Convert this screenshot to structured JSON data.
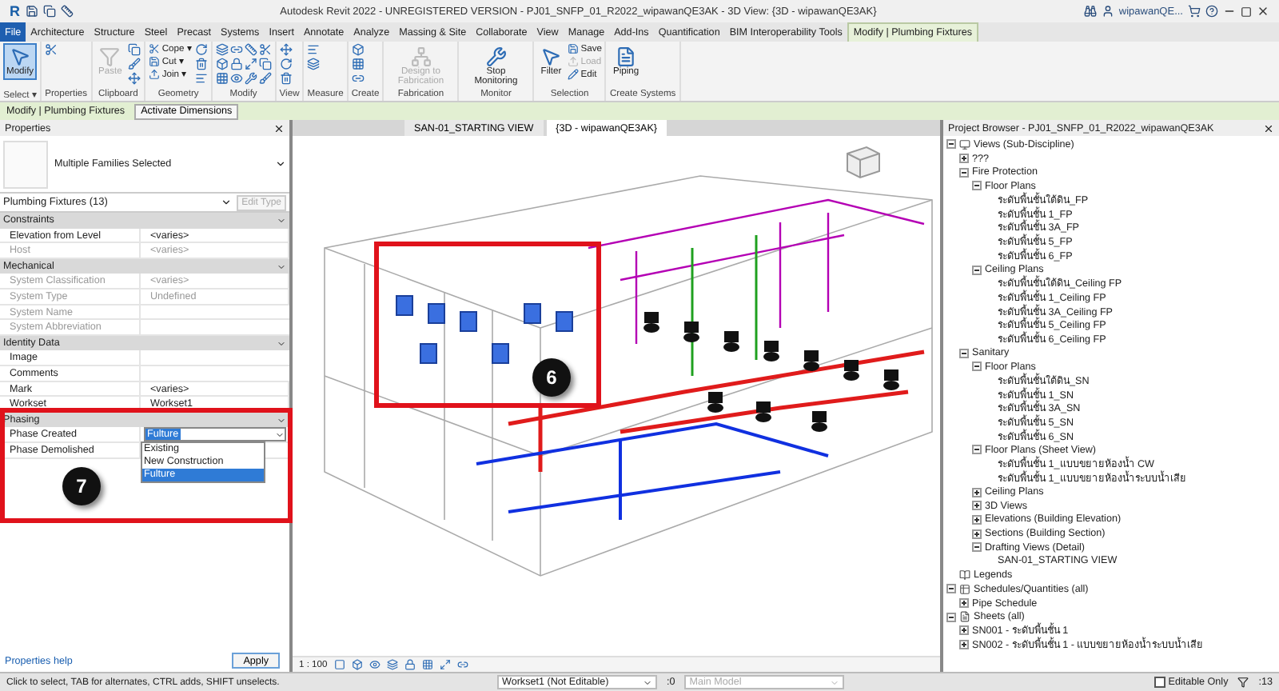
{
  "window": {
    "logo": "R",
    "title": "Autodesk Revit 2022 - UNREGISTERED VERSION - PJ01_SNFP_01_R2022_wipawanQE3AK - 3D View: {3D - wipawanQE3AK}",
    "user": "wipawanQE..."
  },
  "ribbon_tabs": [
    {
      "label": "File",
      "selected": false,
      "kind": "file"
    },
    {
      "label": "Architecture",
      "selected": false
    },
    {
      "label": "Structure",
      "selected": false
    },
    {
      "label": "Steel",
      "selected": false
    },
    {
      "label": "Precast",
      "selected": false
    },
    {
      "label": "Systems",
      "selected": false
    },
    {
      "label": "Insert",
      "selected": false
    },
    {
      "label": "Annotate",
      "selected": false
    },
    {
      "label": "Analyze",
      "selected": false
    },
    {
      "label": "Massing & Site",
      "selected": false
    },
    {
      "label": "Collaborate",
      "selected": false
    },
    {
      "label": "View",
      "selected": false
    },
    {
      "label": "Manage",
      "selected": false
    },
    {
      "label": "Add-Ins",
      "selected": false
    },
    {
      "label": "Quantification",
      "selected": false
    },
    {
      "label": "BIM Interoperability Tools",
      "selected": false
    },
    {
      "label": "Modify | Plumbing Fixtures",
      "selected": true
    }
  ],
  "ribbon_groups": [
    {
      "label": "Select ▾",
      "tools": [
        {
          "kind": "large",
          "label": "Modify",
          "disabled": false,
          "selected": true
        }
      ]
    },
    {
      "label": "Properties",
      "tools": [
        {
          "kind": "icon"
        }
      ]
    },
    {
      "label": "Clipboard",
      "tools": [
        {
          "kind": "large",
          "label": "Paste",
          "disabled": true,
          "selected": false
        },
        {
          "kind": "icon"
        },
        {
          "kind": "icon"
        },
        {
          "kind": "icon"
        }
      ]
    },
    {
      "label": "Geometry",
      "tools": [
        {
          "kind": "small",
          "label": "Cope ▾",
          "disabled": false
        },
        {
          "kind": "small",
          "label": "Cut ▾",
          "disabled": false
        },
        {
          "kind": "small",
          "label": "Join ▾",
          "disabled": false
        },
        {
          "kind": "icon"
        },
        {
          "kind": "icon"
        },
        {
          "kind": "icon"
        }
      ]
    },
    {
      "label": "Modify",
      "tools": [
        {
          "kind": "icon"
        },
        {
          "kind": "icon"
        },
        {
          "kind": "icon"
        },
        {
          "kind": "icon"
        },
        {
          "kind": "icon"
        },
        {
          "kind": "icon"
        },
        {
          "kind": "icon"
        },
        {
          "kind": "icon"
        },
        {
          "kind": "icon"
        },
        {
          "kind": "icon"
        },
        {
          "kind": "icon"
        },
        {
          "kind": "icon"
        }
      ]
    },
    {
      "label": "View",
      "tools": [
        {
          "kind": "icon"
        },
        {
          "kind": "icon"
        },
        {
          "kind": "icon"
        }
      ]
    },
    {
      "label": "Measure",
      "tools": [
        {
          "kind": "icon"
        },
        {
          "kind": "icon"
        }
      ]
    },
    {
      "label": "Create",
      "tools": [
        {
          "kind": "icon"
        },
        {
          "kind": "icon"
        },
        {
          "kind": "icon"
        }
      ]
    },
    {
      "label": "Fabrication",
      "tools": [
        {
          "kind": "large",
          "label": "Design to Fabrication",
          "disabled": true,
          "selected": false
        }
      ]
    },
    {
      "label": "Monitor",
      "tools": [
        {
          "kind": "large",
          "label": "Stop Monitoring",
          "disabled": false,
          "selected": false
        }
      ]
    },
    {
      "label": "Selection",
      "tools": [
        {
          "kind": "large",
          "label": "Filter",
          "disabled": false,
          "selected": false
        },
        {
          "kind": "small",
          "label": "Save",
          "disabled": false
        },
        {
          "kind": "small",
          "label": "Load",
          "disabled": true
        },
        {
          "kind": "small",
          "label": "Edit",
          "disabled": false
        }
      ]
    },
    {
      "label": "Create Systems",
      "tools": [
        {
          "kind": "large",
          "label": "Piping",
          "disabled": false,
          "selected": false
        }
      ]
    }
  ],
  "context_bar": {
    "label": "Modify | Plumbing Fixtures",
    "button": "Activate Dimensions"
  },
  "properties": {
    "title": "Properties",
    "type_name": "Multiple Families Selected",
    "filter": "Plumbing Fixtures (13)",
    "edit_type": "Edit Type",
    "groups": [
      {
        "label": "Constraints",
        "rows": [
          {
            "label": "Elevation from Level",
            "value": "<varies>",
            "disabled": false
          },
          {
            "label": "Host",
            "value": "<varies>",
            "disabled": true
          }
        ]
      },
      {
        "label": "Mechanical",
        "rows": [
          {
            "label": "System Classification",
            "value": "<varies>",
            "disabled": true
          },
          {
            "label": "System Type",
            "value": "Undefined",
            "disabled": true
          },
          {
            "label": "System Name",
            "value": "",
            "disabled": true
          },
          {
            "label": "System Abbreviation",
            "value": "",
            "disabled": true
          }
        ]
      },
      {
        "label": "Identity Data",
        "rows": [
          {
            "label": "Image",
            "value": "",
            "disabled": false
          },
          {
            "label": "Comments",
            "value": "",
            "disabled": false
          },
          {
            "label": "Mark",
            "value": "<varies>",
            "disabled": false
          },
          {
            "label": "Workset",
            "value": "Workset1",
            "disabled": false
          }
        ]
      },
      {
        "label": "Phasing",
        "rows": [
          {
            "label": "Phase Created",
            "value": "Fulture",
            "disabled": false,
            "kind": "dropdown",
            "options": [
              {
                "label": "Existing",
                "selected": false
              },
              {
                "label": "New Construction",
                "selected": false
              },
              {
                "label": "Fulture",
                "selected": true
              }
            ]
          },
          {
            "label": "Phase Demolished",
            "value": "",
            "disabled": false
          }
        ]
      }
    ],
    "help": "Properties help",
    "apply": "Apply"
  },
  "view_tabs": [
    {
      "label": "SAN-01_STARTING VIEW",
      "selected": false
    },
    {
      "label": "{3D - wipawanQE3AK}",
      "selected": true
    }
  ],
  "view_scale": "1 : 100",
  "annotations": [
    {
      "label": "6"
    },
    {
      "label": "7"
    }
  ],
  "project_browser": {
    "title": "Project Browser - PJ01_SNFP_01_R2022_wipawanQE3AK",
    "tree": [
      {
        "label": "Views (Sub-Discipline)",
        "expanded": true,
        "children": [
          {
            "label": "???",
            "expanded": false
          },
          {
            "label": "Fire Protection",
            "expanded": true,
            "children": [
              {
                "label": "Floor Plans",
                "expanded": true,
                "children": [
                  {
                    "label": "ระดับพื้นชั้นใต้ดิน_FP"
                  },
                  {
                    "label": "ระดับพื้นชั้น 1_FP"
                  },
                  {
                    "label": "ระดับพื้นชั้น 3A_FP"
                  },
                  {
                    "label": "ระดับพื้นชั้น 5_FP"
                  },
                  {
                    "label": "ระดับพื้นชั้น 6_FP"
                  }
                ]
              },
              {
                "label": "Ceiling Plans",
                "expanded": true,
                "children": [
                  {
                    "label": "ระดับพื้นชั้นใต้ดิน_Ceiling FP"
                  },
                  {
                    "label": "ระดับพื้นชั้น 1_Ceiling FP"
                  },
                  {
                    "label": "ระดับพื้นชั้น 3A_Ceiling FP"
                  },
                  {
                    "label": "ระดับพื้นชั้น 5_Ceiling FP"
                  },
                  {
                    "label": "ระดับพื้นชั้น 6_Ceiling FP"
                  }
                ]
              }
            ]
          },
          {
            "label": "Sanitary",
            "expanded": true,
            "children": [
              {
                "label": "Floor Plans",
                "expanded": true,
                "children": [
                  {
                    "label": "ระดับพื้นชั้นใต้ดิน_SN"
                  },
                  {
                    "label": "ระดับพื้นชั้น 1_SN"
                  },
                  {
                    "label": "ระดับพื้นชั้น 3A_SN"
                  },
                  {
                    "label": "ระดับพื้นชั้น 5_SN"
                  },
                  {
                    "label": "ระดับพื้นชั้น 6_SN"
                  }
                ]
              },
              {
                "label": "Floor Plans (Sheet View)",
                "expanded": true,
                "children": [
                  {
                    "label": "ระดับพื้นชั้น 1_แบบขยายห้องน้ำ CW"
                  },
                  {
                    "label": "ระดับพื้นชั้น 1_แบบขยายห้องน้ำระบบน้ำเสีย"
                  }
                ]
              },
              {
                "label": "Ceiling Plans",
                "expanded": false
              },
              {
                "label": "3D Views",
                "expanded": false
              },
              {
                "label": "Elevations (Building Elevation)",
                "expanded": false
              },
              {
                "label": "Sections (Building Section)",
                "expanded": false
              },
              {
                "label": "Drafting Views (Detail)",
                "expanded": true,
                "children": [
                  {
                    "label": "SAN-01_STARTING VIEW"
                  }
                ]
              }
            ]
          }
        ]
      },
      {
        "label": "Legends"
      },
      {
        "label": "Schedules/Quantities (all)",
        "expanded": true,
        "children": [
          {
            "label": "Pipe Schedule",
            "expanded": false
          }
        ]
      },
      {
        "label": "Sheets (all)",
        "expanded": true,
        "children": [
          {
            "label": "SN001 - ระดับพื้นชั้น 1",
            "expanded": false
          },
          {
            "label": "SN002 - ระดับพื้นชั้น 1 - แบบขยายห้องน้ำระบบน้ำเสีย",
            "expanded": false
          }
        ]
      }
    ]
  },
  "status_bar": {
    "message": "Click to select, TAB for alternates, CTRL adds, SHIFT unselects.",
    "workset": "Workset1 (Not Editable)",
    "worksets_count": ":0",
    "design_option": "Main Model",
    "editable_only": {
      "label": "Editable Only",
      "checked": false
    },
    "selection_count": ":13"
  }
}
